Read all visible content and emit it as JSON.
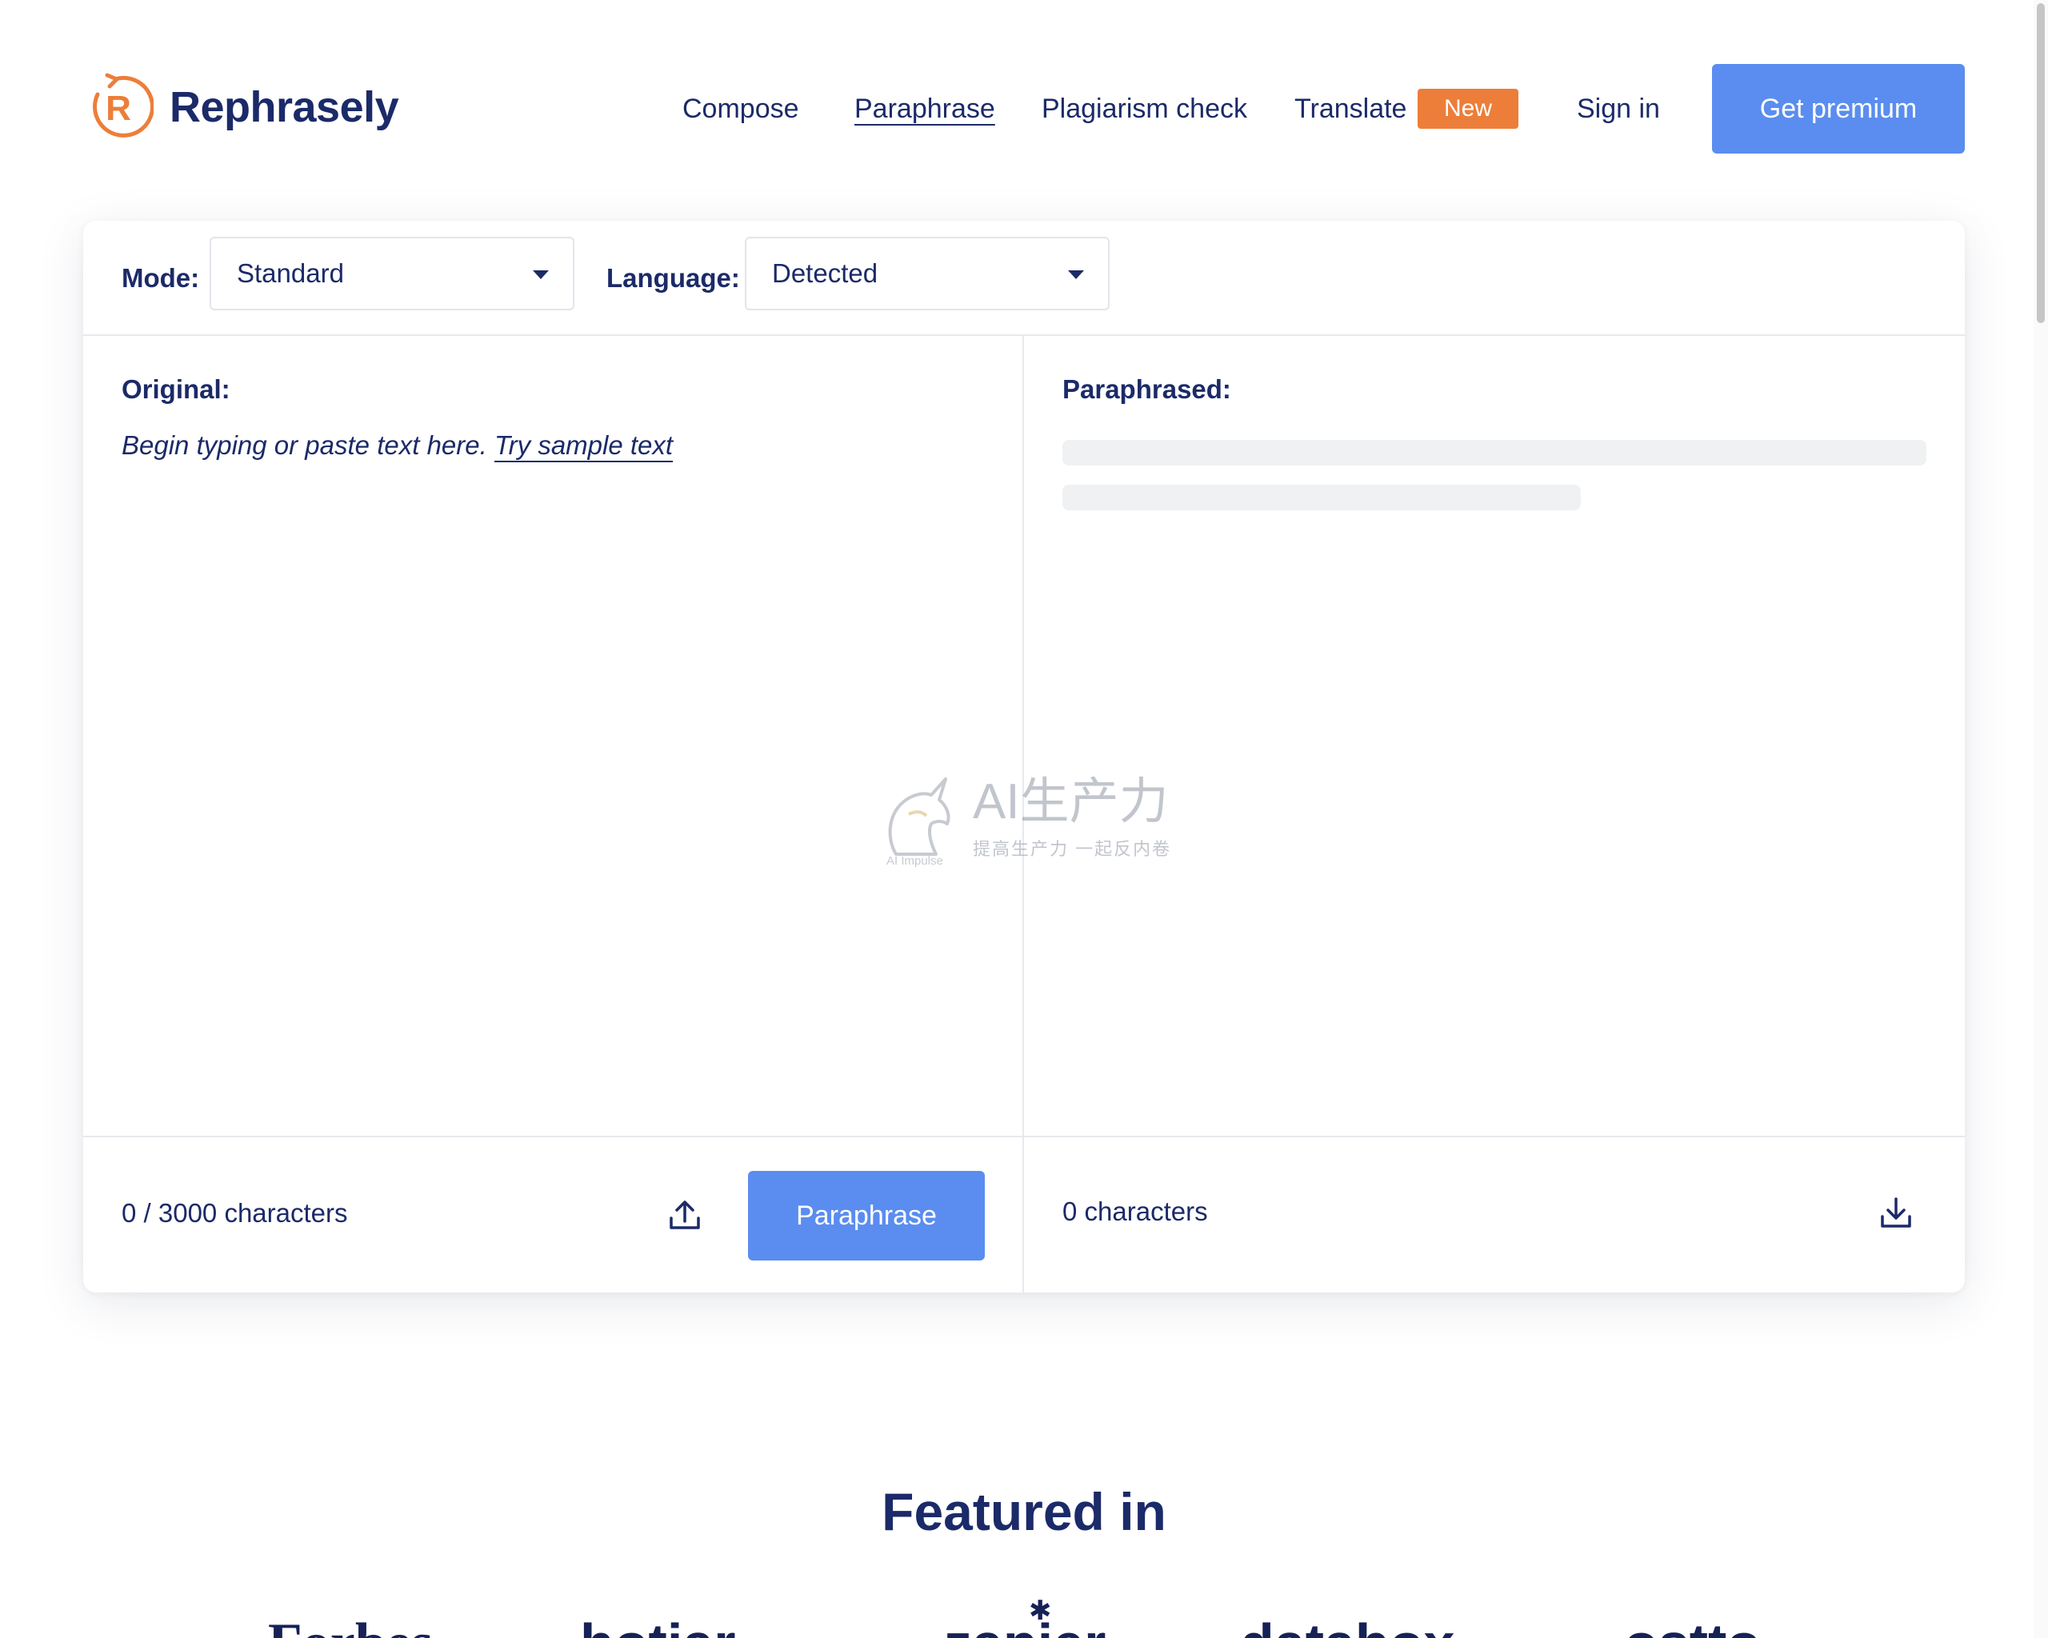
{
  "brand": {
    "name": "Rephrasely",
    "logo_letter": "R",
    "accent": "#ec7e3a",
    "primary": "#5a8def",
    "text": "#1b2a68"
  },
  "nav": {
    "items": [
      {
        "label": "Compose"
      },
      {
        "label": "Paraphrase",
        "active": true
      },
      {
        "label": "Plagiarism check"
      },
      {
        "label": "Translate"
      }
    ],
    "new_badge": "New",
    "sign_in": "Sign in",
    "cta": "Get premium"
  },
  "editor": {
    "mode_label": "Mode:",
    "mode_value": "Standard",
    "language_label": "Language:",
    "language_value": "Detected",
    "original_title": "Original:",
    "placeholder": "Begin typing or paste text here.",
    "sample_link": "Try sample text",
    "paraphrased_title": "Paraphrased:",
    "input_count": "0 / 3000 characters",
    "paraphrase_button": "Paraphrase",
    "output_count": "0 characters",
    "upload_icon": "upload-icon",
    "download_icon": "download-icon"
  },
  "watermark": {
    "title": "AI生产力",
    "subtitle": "提高生产力 一起反内卷",
    "small": "AI Impulse"
  },
  "featured": {
    "title": "Featured in",
    "logos": [
      "Forbes",
      "hotjar",
      "zapier",
      "databox",
      "ostto"
    ]
  }
}
